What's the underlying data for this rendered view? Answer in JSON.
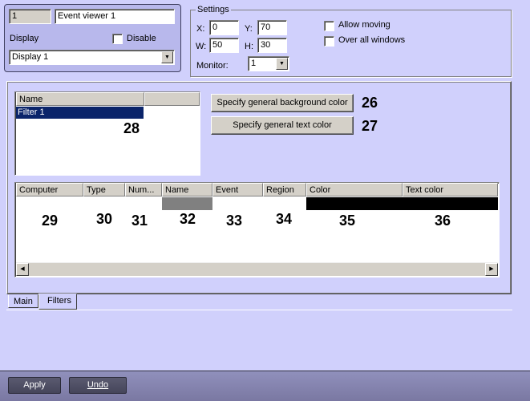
{
  "object": {
    "id": "1",
    "name": "Event viewer 1",
    "display_label": "Display",
    "disable_label": "Disable",
    "display_value": "Display 1"
  },
  "settings": {
    "title": "Settings",
    "x_label": "X:",
    "x": "0",
    "y_label": "Y:",
    "y": "70",
    "w_label": "W:",
    "w": "50",
    "h_label": "H:",
    "h": "30",
    "monitor_label": "Monitor:",
    "monitor": "1",
    "allow_moving": "Allow moving",
    "over_all_windows": "Over all windows"
  },
  "filters": {
    "list_header": "Name",
    "list_items": [
      "Filter 1"
    ],
    "bg_color_button": "Specify general background color",
    "text_color_button": "Specify general text color",
    "columns": [
      "Computer",
      "Type",
      "Num...",
      "Name",
      "Event",
      "Region",
      "Color",
      "Text color"
    ],
    "colors": {
      "name_cell": "#808080",
      "color_cell": "#000000",
      "text_color_cell": "#000000",
      "selection": "#0A246A"
    }
  },
  "callouts": [
    "26",
    "27",
    "28",
    "29",
    "30",
    "31",
    "32",
    "33",
    "34",
    "35",
    "36"
  ],
  "tabs": [
    "Main",
    "Filters"
  ],
  "footer": {
    "apply": "Apply",
    "undo": "Undo"
  }
}
